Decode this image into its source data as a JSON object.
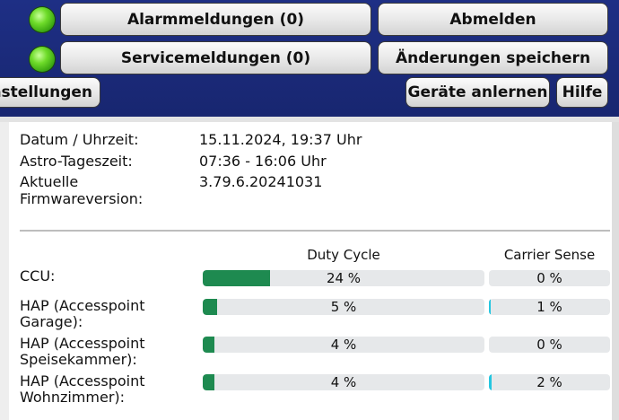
{
  "header": {
    "alarm_button": "Alarmmeldungen (0)",
    "service_button": "Servicemeldungen (0)",
    "logout_button": "Abmelden",
    "save_button": "Änderungen speichern",
    "settings_button": "nstellungen",
    "devices_button": "Geräte anlernen",
    "help_button": "Hilfe",
    "alarm_led": "green-led-icon",
    "service_led": "green-led-icon"
  },
  "info": {
    "date_label": "Datum / Uhrzeit:",
    "date_value": "15.11.2024, 19:37 Uhr",
    "astro_label": "Astro-Tageszeit:",
    "astro_value": "07:36 - 16:06 Uhr",
    "firmware_label_1": "Aktuelle",
    "firmware_label_2": "Firmwareversion:",
    "firmware_value": "3.79.6.20241031"
  },
  "table": {
    "col_duty": "Duty Cycle",
    "col_carrier": "Carrier Sense",
    "rows": [
      {
        "label_1": "CCU:",
        "label_2": "",
        "duty": "24 %",
        "duty_fraction": 0.24,
        "carrier": "0 %",
        "carrier_fraction": 0.0
      },
      {
        "label_1": "HAP (Accesspoint",
        "label_2": "Garage):",
        "duty": "5 %",
        "duty_fraction": 0.05,
        "carrier": "1 %",
        "carrier_fraction": 0.01
      },
      {
        "label_1": "HAP (Accesspoint",
        "label_2": "Speisekammer):",
        "duty": "4 %",
        "duty_fraction": 0.04,
        "carrier": "0 %",
        "carrier_fraction": 0.0
      },
      {
        "label_1": "HAP (Accesspoint",
        "label_2": "Wohnzimmer):",
        "duty": "4 %",
        "duty_fraction": 0.04,
        "carrier": "2 %",
        "carrier_fraction": 0.02
      }
    ]
  },
  "colors": {
    "header_bg": "#1b2a7a",
    "duty_fill": "#1e8a50",
    "carrier_fill": "#25c6e0",
    "bar_track": "#e6e8ea"
  }
}
